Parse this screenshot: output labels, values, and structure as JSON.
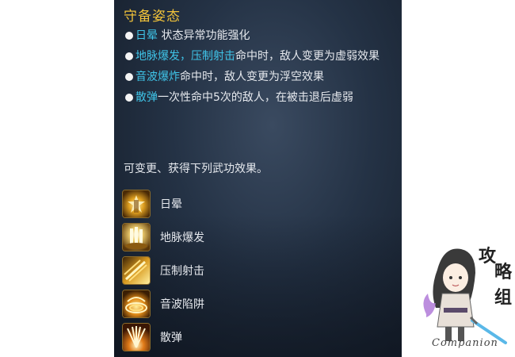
{
  "panel": {
    "title": "守备姿态",
    "effects": [
      {
        "highlight": "日晕",
        "text": " 状态异常功能强化"
      },
      {
        "highlight": "地脉爆发，压制射击",
        "text": "命中时，敌人变更为虚弱效果"
      },
      {
        "highlight": "音波爆炸",
        "text": "命中时，敌人变更为浮空效果"
      },
      {
        "highlight": "散弹",
        "text": "一次性命中5次的敌人，在被击退后虚弱"
      }
    ],
    "note": "可变更、获得下列武功效果。",
    "skills": [
      {
        "label": "日晕",
        "icon": "sun-halo-skill-icon"
      },
      {
        "label": "地脉爆发",
        "icon": "earth-burst-skill-icon"
      },
      {
        "label": "压制射击",
        "icon": "suppress-shot-skill-icon"
      },
      {
        "label": "音波陷阱",
        "icon": "sonic-trap-skill-icon"
      },
      {
        "label": "散弹",
        "icon": "scatter-shot-skill-icon"
      }
    ]
  },
  "watermark": {
    "seal_text": "攻略组",
    "caption": "Companion"
  },
  "colors": {
    "title": "#f0c23a",
    "highlight": "#3fc4e8",
    "text": "#e6e9ee",
    "panel_bg": "#243245"
  }
}
